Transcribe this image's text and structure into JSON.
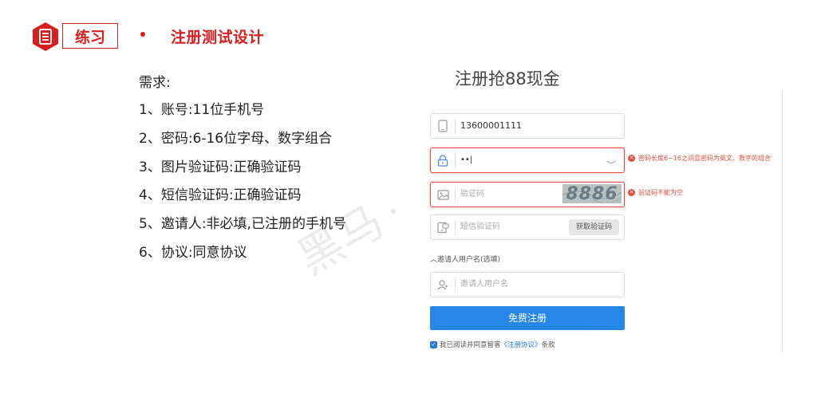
{
  "header": {
    "section_label": "练习",
    "title": "注册测试设计",
    "accent_color": "#d81e1e"
  },
  "requirements": {
    "title": "需求:",
    "items": [
      "1、账号:11位手机号",
      "2、密码:6-16位字母、数字组合",
      "3、图片验证码:正确验证码",
      "4、短信验证码:正确验证码",
      "5、邀请人:非必填,已注册的手机号",
      "6、协议:同意协议"
    ]
  },
  "watermark": "黑马",
  "form": {
    "title": "注册抢88现金",
    "phone": {
      "value": "13600001111",
      "icon": "phone-icon"
    },
    "password": {
      "value": "••",
      "icon": "lock-icon",
      "error": "密码长度6~16之间且密码为英文、数字的组合"
    },
    "captcha": {
      "placeholder": "验证码",
      "icon": "image-icon",
      "captcha_text": "8886",
      "error": "验证码不能为空"
    },
    "sms": {
      "placeholder": "短信验证码",
      "icon": "sms-icon",
      "button": "获取验证码"
    },
    "invite_toggle": "邀请人用户名(选填)",
    "invite": {
      "placeholder": "邀请人用户名",
      "icon": "user-icon"
    },
    "submit": "免费注册",
    "agree": {
      "prefix": "我已阅读并同意智客",
      "link": "《注册协议》",
      "suffix": "条款"
    },
    "primary_color": "#2787e8",
    "error_color": "#e24a3b"
  }
}
